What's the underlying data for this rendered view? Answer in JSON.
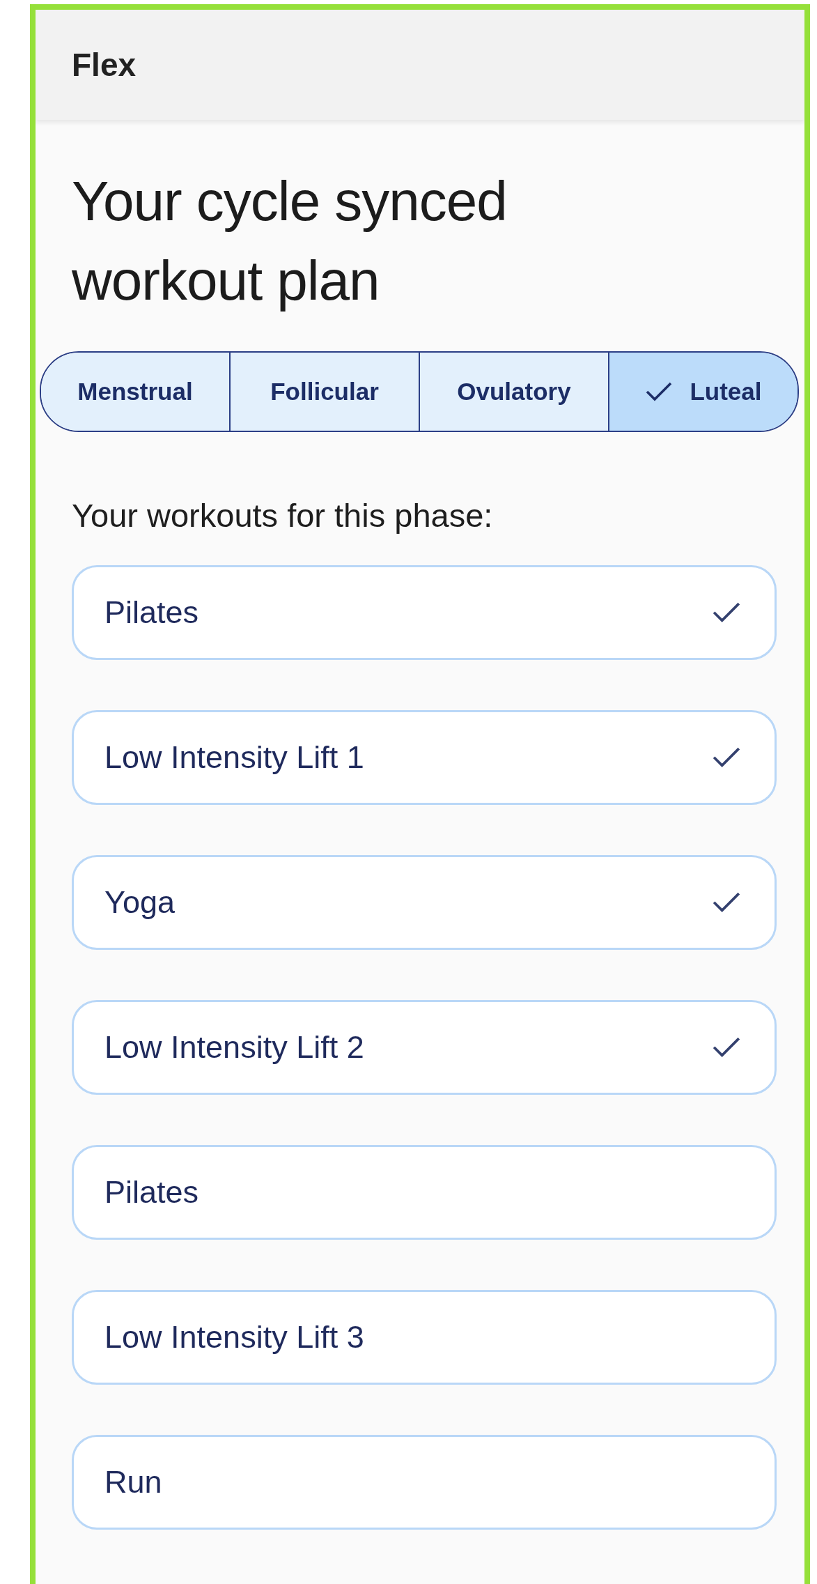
{
  "app_bar": {
    "title": "Flex"
  },
  "heading": "Your cycle synced workout plan",
  "phases": [
    {
      "label": "Menstrual",
      "selected": false
    },
    {
      "label": "Follicular",
      "selected": false
    },
    {
      "label": "Ovulatory",
      "selected": false
    },
    {
      "label": "Luteal",
      "selected": true
    }
  ],
  "section_label": "Your workouts for this phase:",
  "workouts": [
    {
      "name": "Pilates",
      "checked": true
    },
    {
      "name": "Low Intensity Lift 1",
      "checked": true
    },
    {
      "name": "Yoga",
      "checked": true
    },
    {
      "name": "Low Intensity Lift 2",
      "checked": true
    },
    {
      "name": "Pilates",
      "checked": false
    },
    {
      "name": "Low Intensity Lift 3",
      "checked": false
    },
    {
      "name": "Run",
      "checked": false
    }
  ]
}
